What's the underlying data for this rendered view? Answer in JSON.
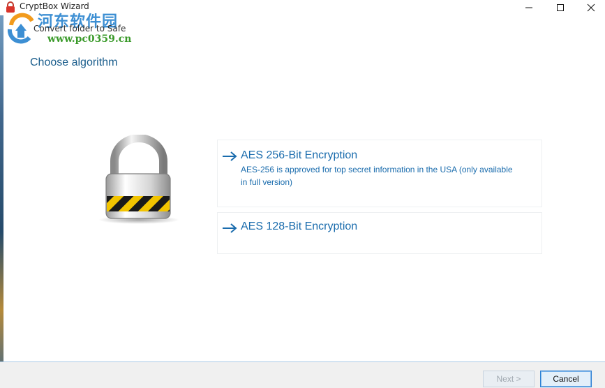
{
  "window": {
    "title": "CryptBox Wizard",
    "controls": [
      "minimize",
      "maximize",
      "close"
    ]
  },
  "watermark": {
    "site_name": "河东软件园",
    "url": "www.pc0359.cn"
  },
  "wizard": {
    "subtitle": "Convert folder to Safe",
    "heading": "Choose algorithm"
  },
  "options": [
    {
      "title": "AES 256-Bit Encryption",
      "description": "AES-256 is approved for top secret information in the USA (only available in full version)"
    },
    {
      "title": "AES 128-Bit Encryption",
      "description": ""
    }
  ],
  "footer": {
    "next_label": "Next >",
    "cancel_label": "Cancel",
    "next_enabled": false
  },
  "colors": {
    "heading": "#1a5d8c",
    "option_text": "#1a6cad",
    "hazard_yellow": "#f2c400",
    "hazard_black": "#1a1a1a"
  }
}
